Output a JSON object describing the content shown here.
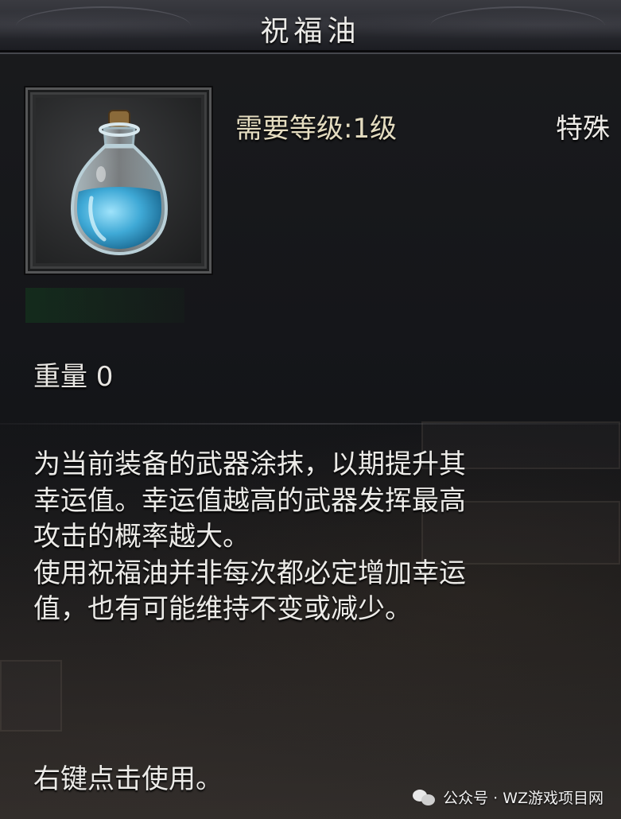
{
  "item": {
    "name": "祝福油",
    "icon": "blue-potion-bottle-icon",
    "level_requirement": "需要等级:1级",
    "type": "特殊",
    "weight": "重量 0",
    "description": [
      "为当前装备的武器涂抹，以期提升其",
      "幸运值。幸运值越高的武器发挥最高",
      "攻击的概率越大。",
      "使用祝福油并非每次都必定增加幸运",
      "值，也有可能维持不变或减少。"
    ],
    "usage_hint": "右键点击使用。"
  },
  "watermark": {
    "icon": "wechat-icon",
    "text": "公众号 · WZ游戏项目网"
  },
  "colors": {
    "title_bar": "#2a2b31",
    "level_text": "#e4dcc0",
    "body_text": "#ecebe8",
    "potion_liquid": "#5fc3e8"
  }
}
